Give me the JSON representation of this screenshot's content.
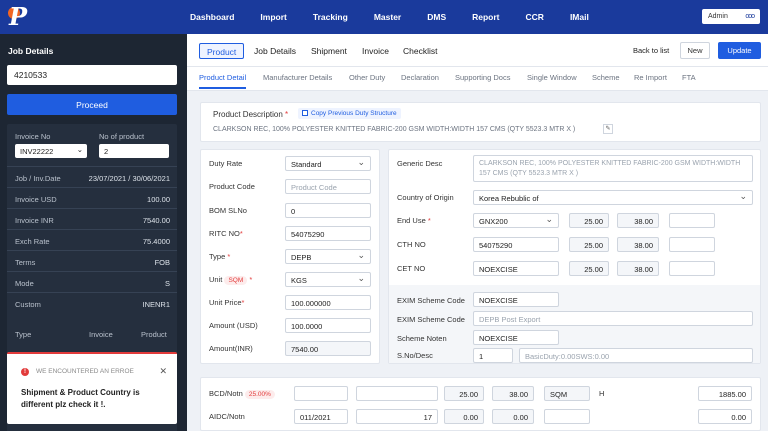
{
  "nav": {
    "items": [
      "Dashboard",
      "Import",
      "Tracking",
      "Master",
      "DMS",
      "Report",
      "CCR",
      "IMail"
    ],
    "user": "Admin",
    "more": "ooo"
  },
  "sidebar": {
    "title": "Job Details",
    "job_input": "4210533",
    "proceed": "Proceed",
    "invoice_no_label": "Invoice No",
    "invoice_no_value": "INV22222",
    "no_of_product_label": "No of product",
    "no_of_product_value": "2",
    "rows": [
      {
        "label": "Job / Inv.Date",
        "value": "23/07/2021  /  30/06/2021"
      },
      {
        "label": "Invoice  USD",
        "value": "100.00"
      },
      {
        "label": "Invoice INR",
        "value": "7540.00"
      },
      {
        "label": "Exch Rate",
        "value": "75.4000"
      },
      {
        "label": "Terms",
        "value": "FOB"
      },
      {
        "label": "Mode",
        "value": "S"
      },
      {
        "label": "Custom",
        "value": "INENR1"
      }
    ],
    "table_headers": [
      "Type",
      "Invoice",
      "Product"
    ]
  },
  "toast": {
    "title": "WE ENCOUNTERED AN ERROE",
    "message": "Shipment & Product Country is different plz check it !."
  },
  "tabs": {
    "primary": [
      "Product",
      "Job Details",
      "Shipment",
      "Invoice",
      "Checklist"
    ],
    "back": "Back to list",
    "new": "New",
    "update": "Update",
    "secondary": [
      "Product Detail",
      "Manufacturer Details",
      "Other Duty",
      "Declaration",
      "Supporting Docs",
      "Single Window",
      "Scheme",
      "Re Import",
      "FTA"
    ]
  },
  "desc": {
    "label": "Product Description",
    "copy": "Copy Previous Duty Structure",
    "text": "CLARKSON REC, 100% POLYESTER KNITTED FABRIC-200 GSM WIDTH:WIDTH 157 CMS (QTY 5523.3 MTR X )"
  },
  "left_form": {
    "duty_rate_label": "Duty Rate",
    "duty_rate": "Standard",
    "product_code_label": "Product Code",
    "product_code_ph": "Product Code",
    "bom_label": "BOM SLNo",
    "bom": "0",
    "ritc_label": "RITC NO",
    "ritc": "54075290",
    "type_label": "Type",
    "type": "DEPB",
    "unit_label": "Unit",
    "unit_badge": "SQM",
    "unit": "KGS",
    "unit_price_label": "Unit Price",
    "unit_price": "100.000000",
    "amount_usd_label": "Amount (USD)",
    "amount_usd": "100.0000",
    "amount_inr_label": "Amount(INR)",
    "amount_inr": "7540.00"
  },
  "right_form": {
    "generic_label": "Generic Desc",
    "generic": "CLARKSON REC, 100% POLYESTER KNITTED FABRIC-200 GSM WIDTH:WIDTH 157 CMS (QTY 5523.3 MTR X )",
    "country_label": "Country of Origin",
    "country": "Korea Rebublic of",
    "end_use_label": "End Use",
    "end_use": "GNX200",
    "end_use_v1": "25.00",
    "end_use_v2": "38.00",
    "cth_label": "CTH NO",
    "cth": "54075290",
    "cth_v1": "25.00",
    "cth_v2": "38.00",
    "cet_label": "CET NO",
    "cet": "NOEXCISE",
    "cet_v1": "25.00",
    "cet_v2": "38.00",
    "exim_code_label": "EXIM Scheme Code",
    "exim_code": "NOEXCISE",
    "exim_code2_label": "EXIM Scheme Code",
    "exim_code2": "DEPB Post Export",
    "scheme_noten_label": "Scheme Noten",
    "scheme_noten": "NOEXCISE",
    "sno_label": "S.No/Desc",
    "sno": "1",
    "sno_desc": "BasicDuty:0.00SWS:0.00"
  },
  "bottom": {
    "bcd_label": "BCD/Notn",
    "bcd_badge": "25.00%",
    "bcd_v1": "25.00",
    "bcd_v2": "38.00",
    "bcd_unit": "SQM",
    "bcd_flag": "H",
    "bcd_total": "1885.00",
    "aidc_label": "AIDC/Notn",
    "aidc_date": "011/2021",
    "aidc_n": "17",
    "aidc_v1": "0.00",
    "aidc_v2": "0.00",
    "aidc_total": "0.00"
  }
}
